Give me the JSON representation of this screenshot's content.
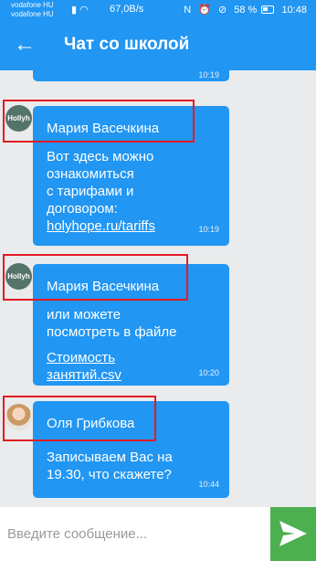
{
  "status_bar": {
    "carrier_1": "vodafone HU",
    "carrier_2": "vodafone HU",
    "net_speed": "67,0B/s",
    "battery": "58 %",
    "time": "10:48"
  },
  "app_bar": {
    "back": "←",
    "title": "Чат со школой"
  },
  "messages": [
    {
      "time": "10:19"
    },
    {
      "sender": "Мария Васечкина",
      "avatar": "Hollyh",
      "lines": [
        "Вот здесь можно",
        "ознакомиться",
        "с тарифами и",
        "договором:"
      ],
      "link": "holyhope.ru/tariffs",
      "time": "10:19"
    },
    {
      "sender": "Мария Васечкина",
      "avatar": "Hollyh",
      "lines": [
        "или можете",
        "посмотреть в файле"
      ],
      "link_lines": [
        "Стоимость",
        "занятий.csv"
      ],
      "time": "10:20"
    },
    {
      "sender": "Оля Грибкова",
      "lines": [
        "Записываем Вас на",
        "19.30, что скажете?"
      ],
      "time": "10:44"
    }
  ],
  "input": {
    "placeholder": "Введите сообщение..."
  },
  "colors": {
    "primary": "#2196f3",
    "send": "#4caf50",
    "highlight": "#e31b23",
    "background": "#e9ebec"
  }
}
